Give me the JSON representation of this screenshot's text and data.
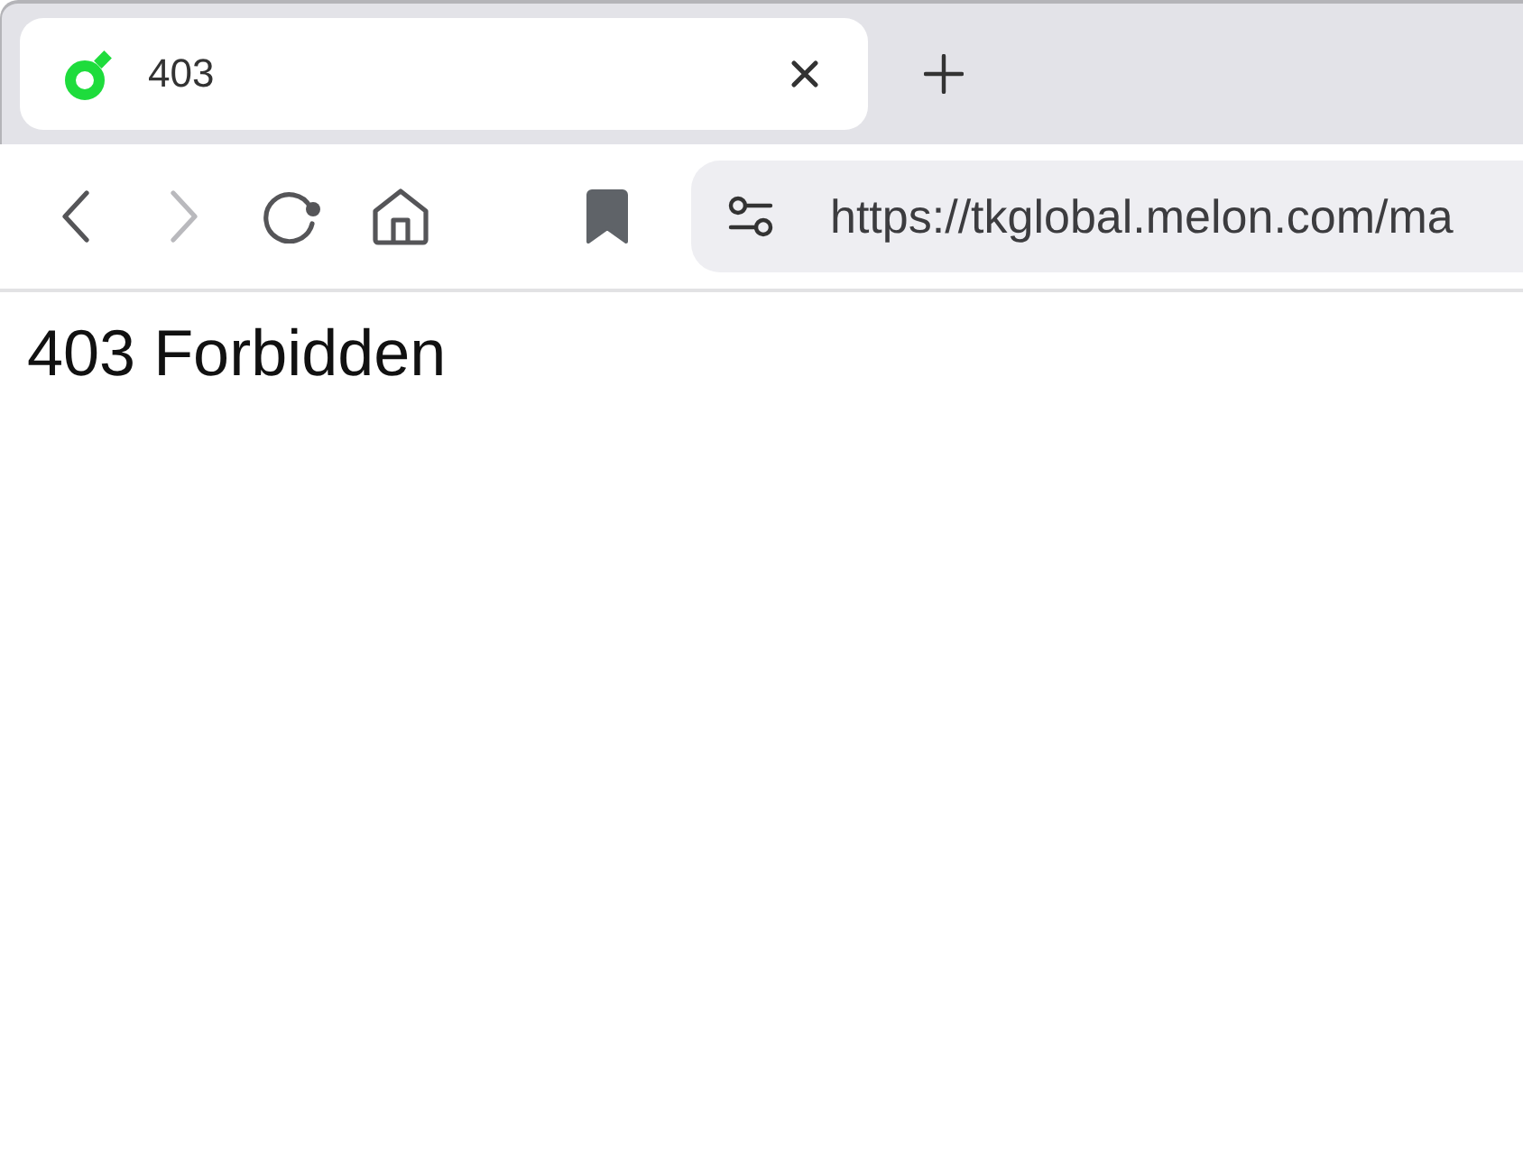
{
  "tabs": [
    {
      "title": "403",
      "selected": true
    }
  ],
  "toolbar": {
    "back": {
      "disabled": false
    },
    "forward": {
      "disabled": true
    }
  },
  "address_bar": {
    "url": "https://tkglobal.melon.com/ma"
  },
  "page": {
    "heading": "403 Forbidden"
  }
}
